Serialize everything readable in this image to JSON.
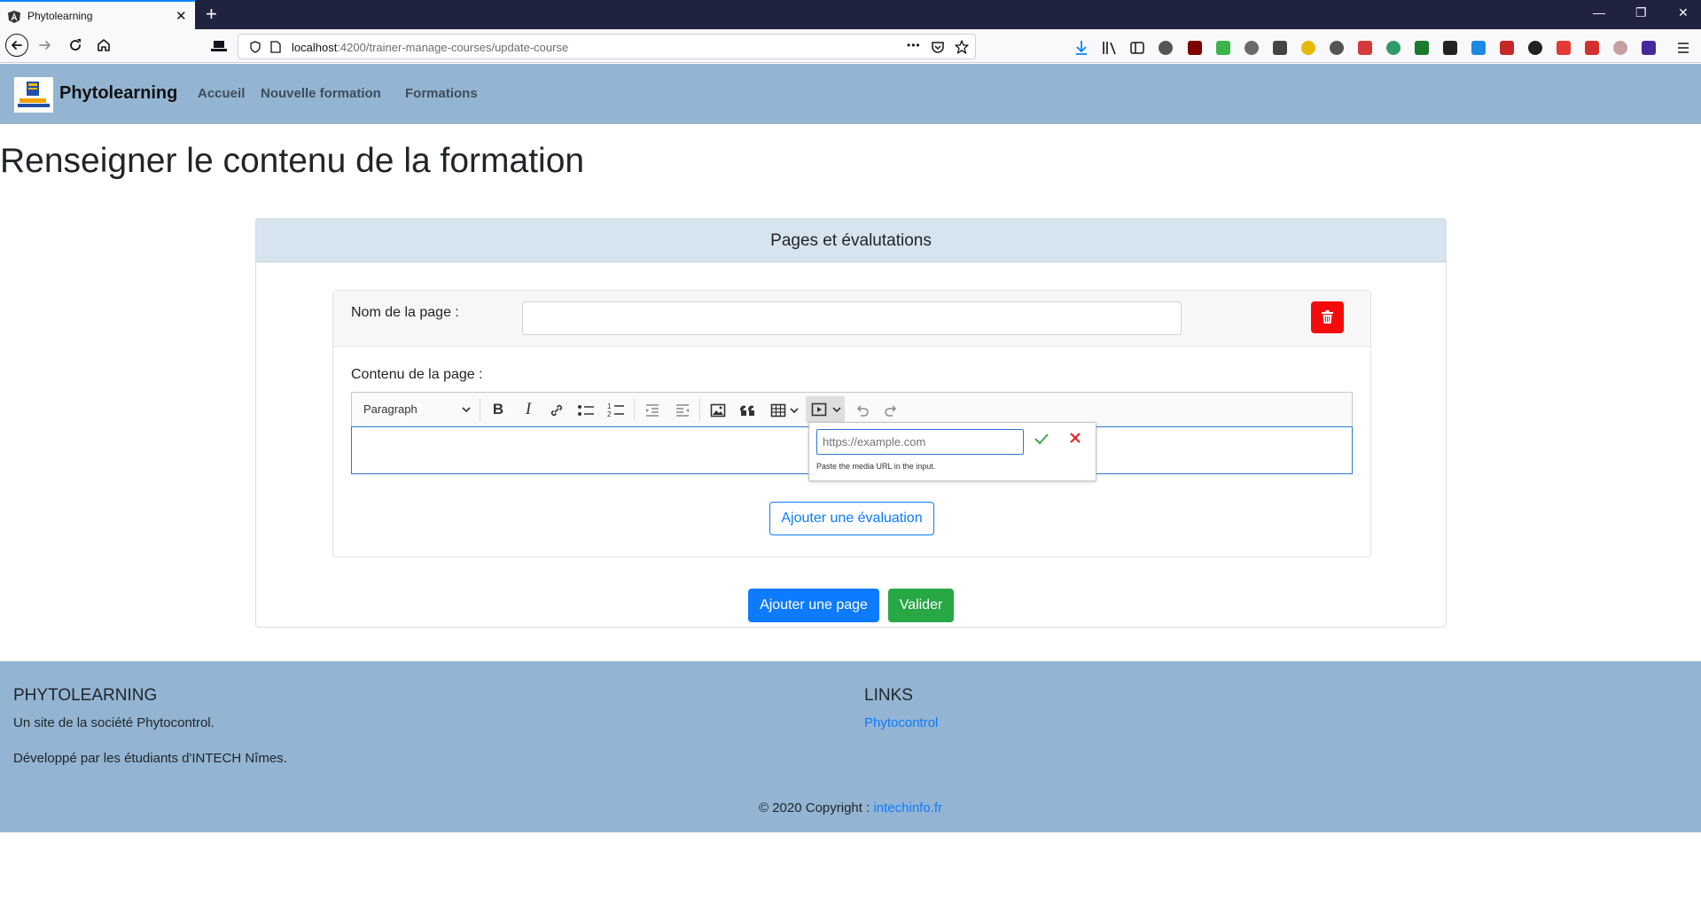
{
  "browser": {
    "tab_title": "Phytolearning",
    "tab_close": "✕",
    "new_tab": "+",
    "url_host": "localhost",
    "url_path": ":4200/trainer-manage-courses/update-course",
    "url_more": "•••",
    "window_minimize": "—",
    "window_restore": "❐",
    "window_close": "✕"
  },
  "app": {
    "brand": "Phytolearning",
    "nav": [
      "Accueil",
      "Nouvelle formation",
      "Formations"
    ]
  },
  "main": {
    "heading": "Renseigner le contenu de la formation",
    "card_title": "Pages et évalutations",
    "page_name_label": "Nom de la page :",
    "page_content_label": "Contenu de la page :",
    "toolbar": {
      "heading_select": "Paragraph"
    },
    "media_popup": {
      "placeholder": "https://example.com",
      "help": "Paste the media URL in the input."
    },
    "add_evaluation": "Ajouter une évaluation",
    "add_page": "Ajouter une page",
    "validate": "Valider"
  },
  "footer": {
    "col1_title": "PHYTOLEARNING",
    "col1_line1": "Un site de la société Phytocontrol.",
    "col1_line2": "Développé par les étudiants d'INTECH Nîmes.",
    "col2_title": "LINKS",
    "col2_link": "Phytocontrol",
    "copyright_text": "© 2020 Copyright : ",
    "copyright_link": "intechinfo.fr"
  },
  "colors": {
    "navbar_bg": "#93b5d3",
    "primary": "#0d7bff",
    "success": "#28a745",
    "danger": "#f50b0b",
    "card_header_bg": "#d6e4ef"
  }
}
